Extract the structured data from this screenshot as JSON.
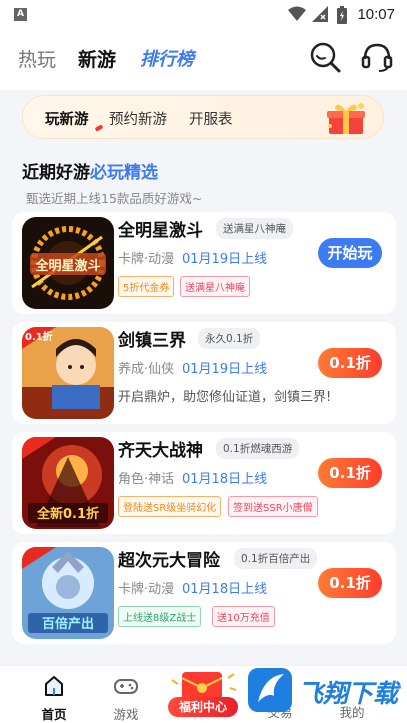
{
  "status_bar": {
    "carrier_icon_letter": "A",
    "time": "10:07"
  },
  "header": {
    "tabs": [
      {
        "label": "热玩"
      },
      {
        "label": "新游"
      },
      {
        "label": "排行榜"
      }
    ]
  },
  "subtabs": {
    "items": [
      "玩新游",
      "预约新游",
      "开服表"
    ]
  },
  "section": {
    "title_part1": "近期好游",
    "title_part2": "必玩精选",
    "subtitle": "甄选近期上线15款品质好游戏~"
  },
  "games": [
    {
      "name": "全明星激斗",
      "badge": "送满星八神庵",
      "category": "卡牌·动漫",
      "date": "01月19日上线",
      "tags": [
        "5折代金券",
        "送满星八神庵"
      ],
      "button": "开始玩",
      "cover_text": "全明星激斗"
    },
    {
      "name": "剑镇三界",
      "badge": "永久0.1折",
      "category": "养成·仙侠",
      "date": "01月19日上线",
      "description": "开启鼎炉，助您修仙证道，剑镇三界!",
      "button": "0.1折",
      "cover_text": "0.1折"
    },
    {
      "name": "齐天大战神",
      "badge": "0.1折燃魂西游",
      "category": "角色·神话",
      "date": "01月18日上线",
      "tags": [
        "登陆送SR级坐骑幻化",
        "签到送SSR小唐僧"
      ],
      "button": "0.1折",
      "cover_text": "全新0.1折"
    },
    {
      "name": "超次元大冒险",
      "badge": "0.1折百倍产出",
      "category": "卡牌·动漫",
      "date": "01月18日上线",
      "tags": [
        "上线送8级Z战士",
        "送10万充值"
      ],
      "button": "0.1折",
      "cover_text": "百倍产出"
    }
  ],
  "bottom_nav": {
    "items": [
      {
        "label": "首页",
        "active": true
      },
      {
        "label": "游戏"
      },
      {
        "label": "福利中心"
      },
      {
        "label": "交易"
      },
      {
        "label": "我的"
      }
    ]
  },
  "watermark": {
    "text": "飞翔下载"
  },
  "colors": {
    "accent": "#3d7bf2",
    "discount": "#ff4a2e",
    "watermark": "#1f7fe0"
  }
}
